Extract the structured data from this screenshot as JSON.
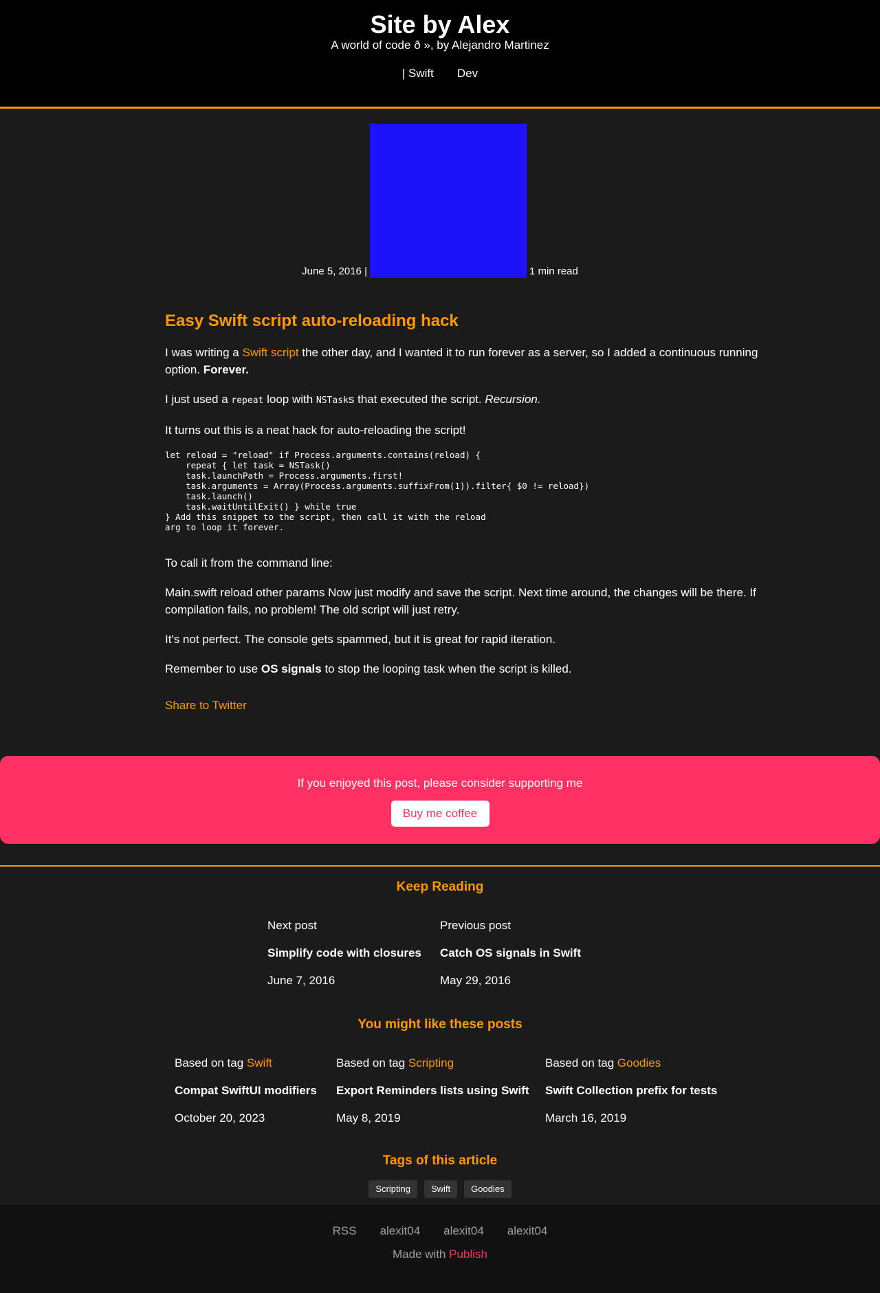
{
  "header": {
    "title": "Site by Alex",
    "subtitle": "A world of code ð       », by Alejandro Martinez",
    "nav": [
      "| Swift",
      "Dev"
    ]
  },
  "meta": {
    "date": "June 5, 2016 |",
    "read_time": "1 min read",
    "cover_color": "#1e12fa"
  },
  "article": {
    "title": "Easy Swift script auto-reloading hack",
    "p1_pre": "I was writing a ",
    "p1_link": "Swift script",
    "p1_post": " the other day, and I wanted it to run forever as a server, so I added a continuous running option. ",
    "p1_bold": "Forever.",
    "p2_pre": "I just used a ",
    "p2_code1": "repeat",
    "p2_mid": " loop with ",
    "p2_code2": "NSTask",
    "p2_post": "s that executed the script. ",
    "p2_italic": "Recursion.",
    "p3": "It turns out this is a neat hack for auto-reloading the script!",
    "code": "let reload = \"reload\" if Process.arguments.contains(reload) {\n    repeat { let task = NSTask()\n    task.launchPath = Process.arguments.first!\n    task.arguments = Array(Process.arguments.suffixFrom(1)).filter{ $0 != reload})\n    task.launch()\n    task.waitUntilExit() } while true\n} Add this snippet to the script, then call it with the reload\narg to loop it forever.",
    "p4": "To call it from the command line:",
    "p5": "Main.swift reload other params Now just modify and save the script. Next time around, the changes will be there. If compilation fails, no problem! The old script will just retry.",
    "p6": "It's not perfect. The console gets spammed, but it is great for rapid iteration.",
    "p7_pre": "Remember to use ",
    "p7_bold": "OS signals",
    "p7_post": " to stop the looping task when the script is killed.",
    "share": "Share to Twitter"
  },
  "support": {
    "text": "If you enjoyed this post, please consider supporting me",
    "button": "Buy me coffee"
  },
  "keep_reading": {
    "heading": "Keep Reading",
    "next": {
      "label": "Next post",
      "title": "Simplify code with closures",
      "date": "June 7, 2016"
    },
    "prev": {
      "label": "Previous post",
      "title": "Catch OS signals in Swift",
      "date": "May 29, 2016"
    }
  },
  "like": {
    "heading": "You might like these posts",
    "items": [
      {
        "label": "Based on tag ",
        "tag": "Swift",
        "title": "Compat SwiftUI modifiers",
        "date": "October 20, 2023"
      },
      {
        "label": "Based on tag ",
        "tag": "Scripting",
        "title": "Export Reminders lists using Swift",
        "date": "May 8, 2019"
      },
      {
        "label": "Based on tag ",
        "tag": "Goodies",
        "title": "Swift Collection prefix for tests",
        "date": "March 16, 2019"
      }
    ]
  },
  "tags": {
    "heading": "Tags of this article",
    "items": [
      "Scripting",
      "Swift",
      "Goodies"
    ]
  },
  "footer": {
    "links": [
      "RSS",
      "alexit04",
      "alexit04",
      "alexit04"
    ],
    "made_with": "Made with ",
    "publish": "Publish"
  }
}
